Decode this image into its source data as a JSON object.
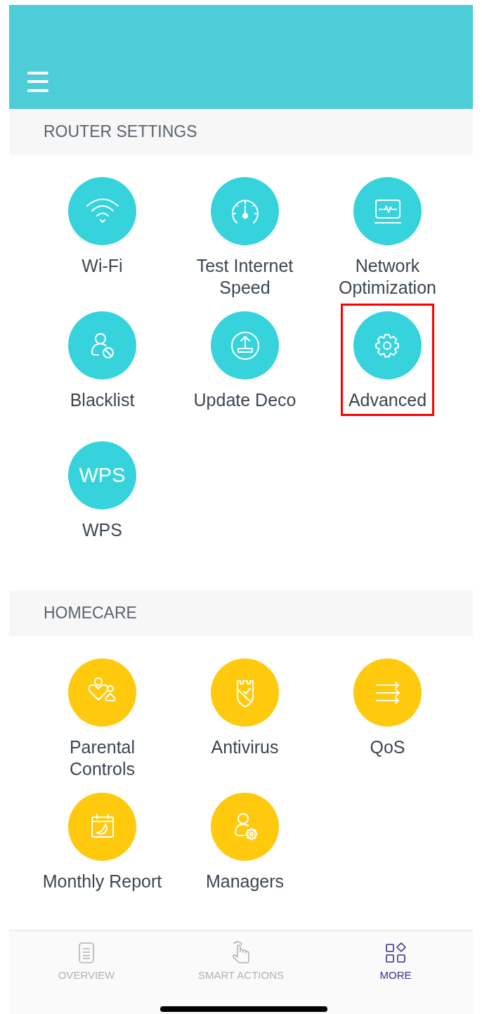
{
  "header": {
    "menu": "☰"
  },
  "sections": [
    {
      "title": "ROUTER SETTINGS",
      "color": "#36d3dc",
      "items": [
        {
          "label": "Wi-Fi",
          "kind": "wifi",
          "highlighted": false
        },
        {
          "label": "Test Internet Speed",
          "kind": "speed",
          "highlighted": false
        },
        {
          "label": "Network Optimization",
          "kind": "monitor",
          "highlighted": false
        },
        {
          "label": "Blacklist",
          "kind": "blockuser",
          "highlighted": false
        },
        {
          "label": "Update Deco",
          "kind": "upload",
          "highlighted": false
        },
        {
          "label": "Advanced",
          "kind": "gear",
          "highlighted": true
        },
        {
          "label": "WPS",
          "kind": "text",
          "icon_text": "WPS",
          "highlighted": false
        }
      ]
    },
    {
      "title": "HOMECARE",
      "color": "#ffca0d",
      "items": [
        {
          "label": "Parental Controls",
          "kind": "family",
          "highlighted": false
        },
        {
          "label": "Antivirus",
          "kind": "shield",
          "highlighted": false
        },
        {
          "label": "QoS",
          "kind": "arrows",
          "highlighted": false
        },
        {
          "label": "Monthly Report",
          "kind": "calendar",
          "highlighted": false
        },
        {
          "label": "Managers",
          "kind": "usergear",
          "highlighted": false
        }
      ]
    }
  ],
  "nav": [
    {
      "label": "OVERVIEW",
      "kind": "doc",
      "selected": false
    },
    {
      "label": "SMART ACTIONS",
      "kind": "hand",
      "selected": false
    },
    {
      "label": "MORE",
      "kind": "grid",
      "selected": true
    }
  ]
}
